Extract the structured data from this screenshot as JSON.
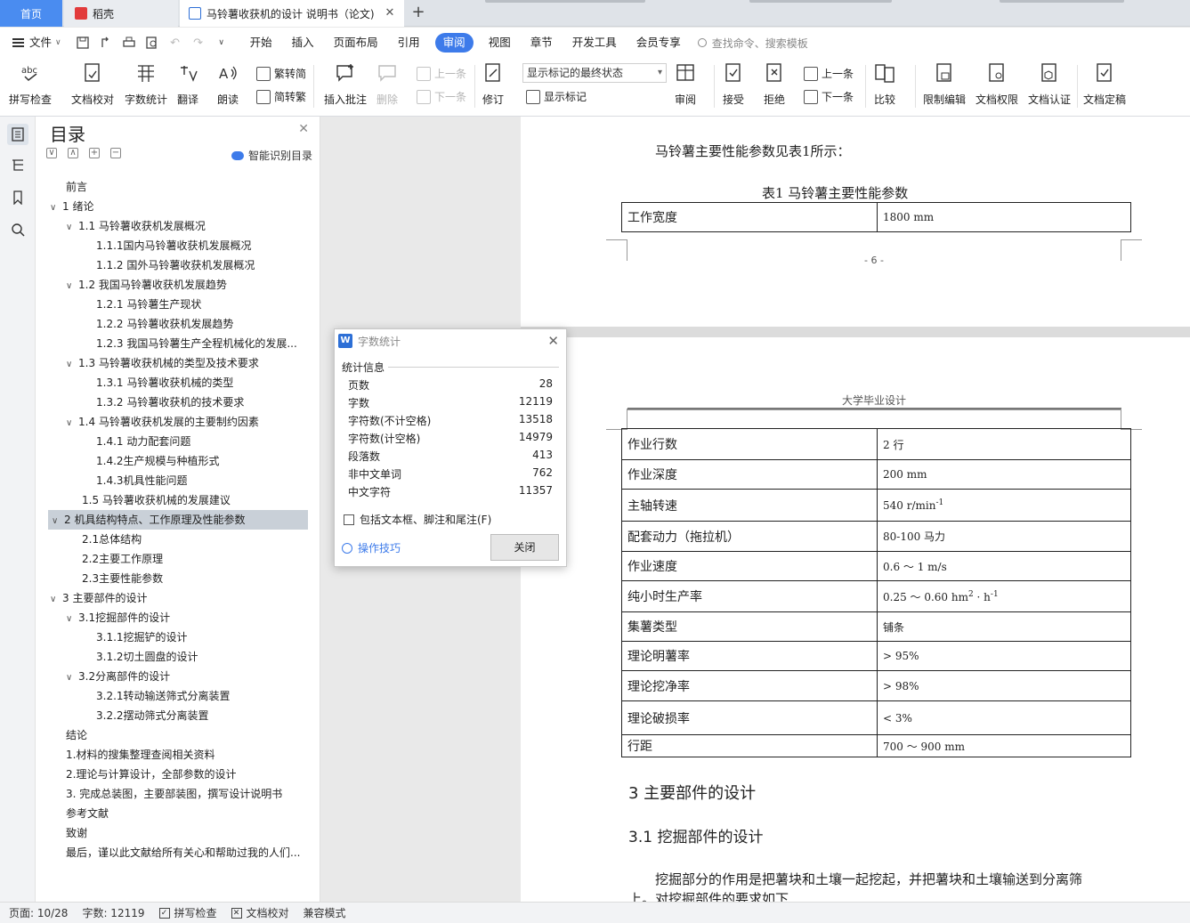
{
  "tabs": {
    "home": "首页",
    "doc1": "稻壳",
    "doc2": "马铃薯收获机的设计 说明书（论文)",
    "add": "+"
  },
  "menu": {
    "file": "文件",
    "items": [
      "开始",
      "插入",
      "页面布局",
      "引用",
      "审阅",
      "视图",
      "章节",
      "开发工具",
      "会员专享"
    ],
    "active": "审阅",
    "search_placeholder": "查找命令、搜索模板"
  },
  "ribbon": {
    "spell": "拼写检查",
    "proof": "文档校对",
    "wordcount": "字数统计",
    "translate": "翻译",
    "read": "朗读",
    "trad": "繁转简",
    "simp": "简转繁",
    "insert_comment": "插入批注",
    "delete": "删除",
    "prev1": "上一条",
    "next1": "下一条",
    "track": "修订",
    "markup_state": "显示标记的最终状态",
    "show_markup": "显示标记",
    "review": "审阅",
    "accept": "接受",
    "reject": "拒绝",
    "prev2": "上一条",
    "next2": "下一条",
    "compare": "比较",
    "restrict": "限制编辑",
    "doc_perm": "文档权限",
    "doc_cert": "文档认证",
    "doc_final": "文档定稿"
  },
  "toc": {
    "title": "目录",
    "smart": "智能识别目录",
    "items": [
      {
        "text": "前言",
        "level": 0,
        "chev": ""
      },
      {
        "text": "1  绪论",
        "level": 0,
        "chev": "v"
      },
      {
        "text": "1.1  马铃薯收获机发展概况",
        "level": 1,
        "chev": "v"
      },
      {
        "text": "1.1.1国内马铃薯收获机发展概况",
        "level": 2,
        "chev": ""
      },
      {
        "text": "1.1.2  国外马铃薯收获机发展概况",
        "level": 2,
        "chev": ""
      },
      {
        "text": "1.2  我国马铃薯收获机发展趋势",
        "level": 1,
        "chev": "v"
      },
      {
        "text": "1.2.1  马铃薯生产现状",
        "level": 2,
        "chev": ""
      },
      {
        "text": "1.2.2  马铃薯收获机发展趋势",
        "level": 2,
        "chev": ""
      },
      {
        "text": "1.2.3  我国马铃薯生产全程机械化的发展...",
        "level": 2,
        "chev": ""
      },
      {
        "text": "1.3  马铃薯收获机械的类型及技术要求",
        "level": 1,
        "chev": "v"
      },
      {
        "text": "1.3.1  马铃薯收获机械的类型",
        "level": 2,
        "chev": ""
      },
      {
        "text": "1.3.2  马铃薯收获机的技术要求",
        "level": 2,
        "chev": ""
      },
      {
        "text": "1.4  马铃薯收获机发展的主要制约因素",
        "level": 1,
        "chev": "v"
      },
      {
        "text": "1.4.1  动力配套问题",
        "level": 2,
        "chev": ""
      },
      {
        "text": "1.4.2生产规模与种植形式",
        "level": 2,
        "chev": ""
      },
      {
        "text": "1.4.3机具性能问题",
        "level": 2,
        "chev": ""
      },
      {
        "text": "1.5    马铃薯收获机械的发展建议",
        "level": 1,
        "chev": ""
      },
      {
        "text": "2   机具结构特点、工作原理及性能参数",
        "level": 0,
        "chev": "v",
        "selected": true
      },
      {
        "text": "2.1总体结构",
        "level": 1,
        "chev": ""
      },
      {
        "text": "2.2主要工作原理",
        "level": 1,
        "chev": ""
      },
      {
        "text": "2.3主要性能参数",
        "level": 1,
        "chev": ""
      },
      {
        "text": "3  主要部件的设计",
        "level": 0,
        "chev": "v"
      },
      {
        "text": "3.1挖掘部件的设计",
        "level": 1,
        "chev": "v"
      },
      {
        "text": "3.1.1挖掘铲的设计",
        "level": 2,
        "chev": ""
      },
      {
        "text": "3.1.2切土圆盘的设计",
        "level": 2,
        "chev": ""
      },
      {
        "text": "3.2分离部件的设计",
        "level": 1,
        "chev": "v"
      },
      {
        "text": "3.2.1转动输送筛式分离装置",
        "level": 2,
        "chev": ""
      },
      {
        "text": "3.2.2摆动筛式分离装置",
        "level": 2,
        "chev": ""
      },
      {
        "text": "结论",
        "level": 0,
        "chev": ""
      },
      {
        "text": "1.材料的搜集整理查阅相关资料",
        "level": 0,
        "chev": ""
      },
      {
        "text": "2.理论与计算设计，全部参数的设计",
        "level": 0,
        "chev": ""
      },
      {
        "text": "3. 完成总装图，主要部装图，撰写设计说明书",
        "level": 0,
        "chev": ""
      },
      {
        "text": "参考文献",
        "level": 0,
        "chev": ""
      },
      {
        "text": "致谢",
        "level": 0,
        "chev": ""
      },
      {
        "text": "最后，谨以此文献给所有关心和帮助过我的人们...",
        "level": 0,
        "chev": ""
      }
    ]
  },
  "page1": {
    "intro": "马铃薯主要性能参数见表1所示：",
    "caption": "表1  马铃薯主要性能参数",
    "row_label": "工作宽度",
    "row_value": "1800   mm",
    "page_number": "- 6 -"
  },
  "page2": {
    "header": "大学毕业设计",
    "rows": [
      {
        "label": "作业行数",
        "value": "2    行"
      },
      {
        "label": "作业深度",
        "value": "200   mm"
      },
      {
        "label": "主轴转速",
        "value": "540   r/min",
        "sup": "-1"
      },
      {
        "label": "配套动力（拖拉机）",
        "value": "80-100   马力"
      },
      {
        "label": "作业速度",
        "value": "0.6  ～  1   m/s"
      },
      {
        "label": "纯小时生产率",
        "value": "0.25  ～  0.60   hm",
        "sup": "2",
        "value2": " · h",
        "sup2": "-1"
      },
      {
        "label": "集薯类型",
        "value": "铺条"
      },
      {
        "label": "理论明薯率",
        "value": "> 95%"
      },
      {
        "label": "理论挖净率",
        "value": "> 98%"
      },
      {
        "label": "理论破损率",
        "value": "< 3%"
      },
      {
        "label": "  行距",
        "value": "  700  ～  900   mm"
      }
    ],
    "h1": "3  主要部件的设计",
    "h2": "3.1 挖掘部件的设计",
    "para1": "挖掘部分的作用是把薯块和土壤一起挖起，并把薯块和土壤输送到分离筛",
    "para2": "上。对挖掘部件的要求如下"
  },
  "dialog": {
    "title": "字数统计",
    "section": "统计信息",
    "stats": [
      {
        "label": "页数",
        "value": "28"
      },
      {
        "label": "字数",
        "value": "12119"
      },
      {
        "label": "字符数(不计空格)",
        "value": "13518"
      },
      {
        "label": "字符数(计空格)",
        "value": "14979"
      },
      {
        "label": "段落数",
        "value": "413"
      },
      {
        "label": "非中文单词",
        "value": "762"
      },
      {
        "label": "中文字符",
        "value": "11357"
      }
    ],
    "checkbox": "包括文本框、脚注和尾注(F)",
    "tips": "操作技巧",
    "close": "关闭"
  },
  "status": {
    "page": "页面: 10/28",
    "words": "字数: 12119",
    "spell": "拼写检查",
    "proof": "文档校对",
    "compat": "兼容模式"
  },
  "colors": {
    "accent": "#3d7bea",
    "home_tab": "#4a8cf0",
    "selected_toc": "#c9d0d8"
  }
}
